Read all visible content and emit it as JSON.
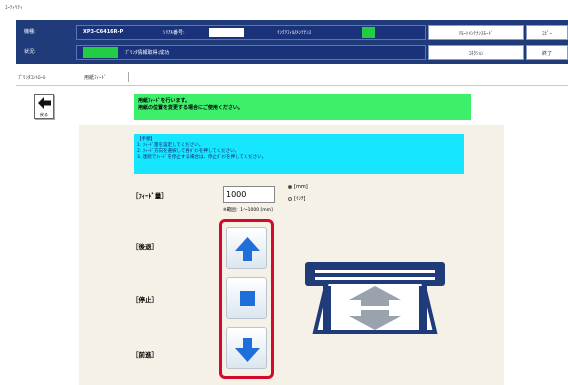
{
  "window": {
    "title": "ﾕｰﾃｨﾘﾃｨ"
  },
  "header": {
    "model_label": "機種:",
    "model_value": "XP3-C6416R-P",
    "serial_label": "ｼﾘｱﾙ番号:",
    "info_label": "ｲﾝｸﾘﾌｨﾙ/ﾒﾝﾃﾅﾝｽ",
    "status_label": "状況:",
    "status_value": "ﾌﾟﾘﾝﾀ情報取得:成功",
    "button_mode": "ﾘﾓｰﾄﾒﾝﾃﾅﾝｽﾓｰﾄﾞ",
    "button_right": "ｺﾋﾟｰ",
    "button_connect": "ｺﾈｸｼｮﾝ",
    "button_exit": "終了",
    "accent_color": "#1f3b7a",
    "status_color": "#22cc44"
  },
  "tabs": {
    "items": [
      "ﾌﾟﾘﾝﾀｺﾝﾄﾛｰﾙ",
      "用紙ﾌｨｰﾄﾞ"
    ]
  },
  "back": {
    "label": "戻る",
    "icon": "arrow-left-icon"
  },
  "message": {
    "line1": "用紙ﾌｨｰﾄﾞを行います。",
    "line2": "用紙の位置を変更する場合にご使用ください。"
  },
  "instructions": {
    "heading": "【手順】",
    "step1": "1. ﾌｨｰﾄﾞ量を設定してください。",
    "step2": "2. ﾌｨｰﾄﾞ方向を選択して各ﾎﾞﾀﾝを押してください。",
    "step3": "3. 連続でﾌｨｰﾄﾞを停止する場合は、停止ﾎﾞﾀﾝを押してください。"
  },
  "feed": {
    "label": "［ﾌｨｰﾄﾞ量］",
    "value": "1000",
    "unit_mm": "[mm]",
    "unit_inch": "[ｲﾝﾁ]",
    "unit_selected": "mm",
    "range": "※範囲：1～1000 [mm]"
  },
  "controls": {
    "backward_label": "［後退］",
    "stop_label": "［停止］",
    "forward_label": "［前進］",
    "backward_icon": "arrow-up-icon",
    "stop_icon": "stop-square-icon",
    "forward_icon": "arrow-down-icon",
    "button_color": "#1e6fd9",
    "highlight_color": "#d40a2a"
  },
  "illustration": {
    "icon": "printer-feed-icon",
    "color": "#1f3b7a"
  }
}
